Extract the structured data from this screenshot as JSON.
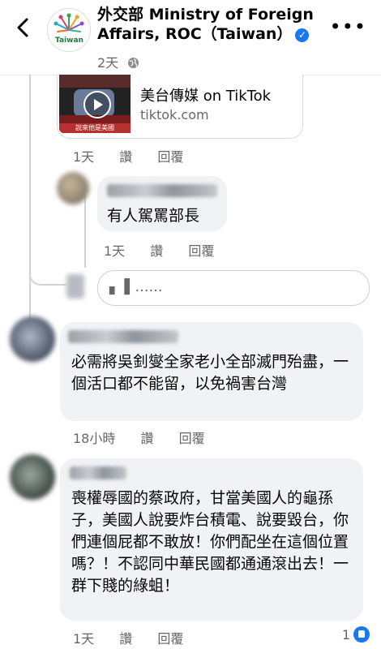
{
  "header": {
    "title": "外交部 Ministry of Foreign Affairs, ROC（Taiwan）",
    "post_time": "2天",
    "avatar_text": "Taiwan",
    "back_icon": "chevron-left-icon",
    "more_icon": "more-horizontal-icon",
    "verified_icon": "verified-badge-icon",
    "privacy_icon": "globe-icon"
  },
  "link_card": {
    "title": "美台傳媒 on TikTok",
    "domain": "tiktok.com",
    "thumb_caption": "說來他是美國"
  },
  "comments": [
    {
      "time": "1天",
      "like": "讚",
      "reply": "回覆"
    },
    {
      "text": "有人駕罵部長",
      "time": "1天",
      "like": "讚",
      "reply": "回覆"
    },
    {
      "text": "必需將吳釗燮全家老小全部滅門殆盡，一個活口都不能留，以免禍害台灣",
      "time": "18小時",
      "like": "讚",
      "reply": "回覆"
    },
    {
      "text": "喪權辱國的蔡政府，甘當美國人的龜孫子，美國人說要炸台積電、說要毀台，你們連個屁都不敢放！你們配坐在這個位置嗎？！不認同中華民國都通通滾出去！一群下賤的綠蛆！",
      "time": "1天",
      "like": "讚",
      "reply": "回覆",
      "reaction_count": "1"
    }
  ],
  "reply_box": {
    "draft": "▖ ▌……"
  },
  "colors": {
    "accent": "#1877f2",
    "bubble": "#f0f2f5",
    "muted": "#65676b"
  }
}
